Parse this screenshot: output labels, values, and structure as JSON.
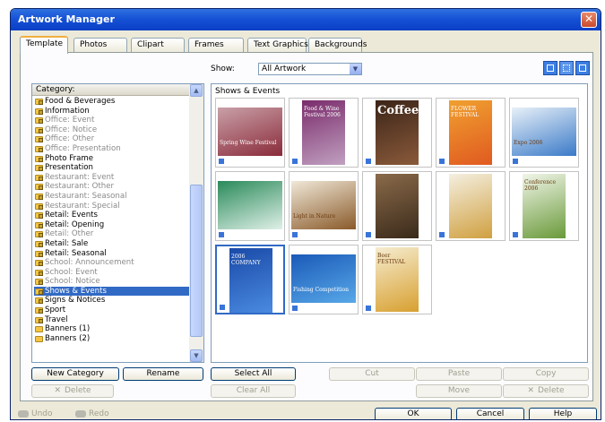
{
  "window": {
    "title": "Artwork Manager",
    "close_glyph": "✕"
  },
  "tabs": [
    {
      "label": "Template",
      "active": true
    },
    {
      "label": "Photos"
    },
    {
      "label": "Clipart"
    },
    {
      "label": "Frames"
    },
    {
      "label": "Text Graphics"
    },
    {
      "label": "Backgrounds"
    }
  ],
  "filter": {
    "show_label": "Show:",
    "show_value": "All Artwork"
  },
  "category": {
    "header": "Category:",
    "items": [
      {
        "label": "Food & Beverages"
      },
      {
        "label": "Information"
      },
      {
        "label": "Office: Event",
        "grey": true
      },
      {
        "label": "Office: Notice",
        "grey": true
      },
      {
        "label": "Office: Other",
        "grey": true
      },
      {
        "label": "Office: Presentation",
        "grey": true
      },
      {
        "label": "Photo Frame"
      },
      {
        "label": "Presentation"
      },
      {
        "label": "Restaurant: Event",
        "grey": true
      },
      {
        "label": "Restaurant: Other",
        "grey": true
      },
      {
        "label": "Restaurant: Seasonal",
        "grey": true
      },
      {
        "label": "Restaurant: Special",
        "grey": true
      },
      {
        "label": "Retail: Events"
      },
      {
        "label": "Retail: Opening"
      },
      {
        "label": "Retail: Other",
        "grey": true
      },
      {
        "label": "Retail: Sale"
      },
      {
        "label": "Retail: Seasonal"
      },
      {
        "label": "School: Announcement",
        "grey": true
      },
      {
        "label": "School: Event",
        "grey": true
      },
      {
        "label": "School: Notice",
        "grey": true
      },
      {
        "label": "Shows & Events",
        "selected": true
      },
      {
        "label": "Signs & Notices"
      },
      {
        "label": "Sport"
      },
      {
        "label": "Travel"
      },
      {
        "label": "Banners (1)",
        "unlocked": true
      },
      {
        "label": "Banners (2)",
        "unlocked": true
      }
    ]
  },
  "artwork": {
    "heading": "Shows & Events",
    "thumbnails": [
      {
        "name": "spring-wine-festival",
        "text": "Spring Wine Festival",
        "colors": [
          "#c9a0a8",
          "#8a2b3a"
        ]
      },
      {
        "name": "food-wine-festival",
        "text": "Food & Wine Festival 2006",
        "colors": [
          "#7a2b6b",
          "#c0a0c0"
        ]
      },
      {
        "name": "coffee",
        "text": "Coffee",
        "colors": [
          "#3b2418",
          "#8a5a3a"
        ]
      },
      {
        "name": "flower-festival",
        "text": "FLOWER FESTIVAL",
        "colors": [
          "#f0a030",
          "#e05a20"
        ]
      },
      {
        "name": "expo-2006",
        "text": "Expo 2006",
        "colors": [
          "#e8f0f8",
          "#3a7ac8"
        ]
      },
      {
        "name": "green-event",
        "text": "",
        "colors": [
          "#2a8a5a",
          "#e0f0e8"
        ]
      },
      {
        "name": "light-in-nature",
        "text": "Light in Nature",
        "colors": [
          "#f0e8d8",
          "#8a5a2a"
        ]
      },
      {
        "name": "wood-carving",
        "text": "",
        "colors": [
          "#8a6a4a",
          "#3a2a1a"
        ]
      },
      {
        "name": "garden-show",
        "text": "",
        "colors": [
          "#f4efe0",
          "#d0a040"
        ]
      },
      {
        "name": "conference-2006",
        "text": "Conference 2006",
        "colors": [
          "#f0f5e8",
          "#6a9a3a"
        ]
      },
      {
        "name": "company-technology",
        "text": "2006 COMPANY",
        "colors": [
          "#1a4aa8",
          "#4a8ae0"
        ]
      },
      {
        "name": "fishing-competition",
        "text": "Fishing Competition",
        "colors": [
          "#1a5ab8",
          "#58a8e8"
        ]
      },
      {
        "name": "beer-festival",
        "text": "Beer FESTIVAL",
        "colors": [
          "#f5ecd0",
          "#d8a030"
        ]
      }
    ]
  },
  "buttons": {
    "new_category": "New Category",
    "rename": "Rename",
    "delete": "Delete",
    "select_all": "Select All",
    "clear_all": "Clear All",
    "cut": "Cut",
    "paste": "Paste",
    "copy": "Copy",
    "move": "Move",
    "delete_right": "Delete",
    "undo": "Undo",
    "redo": "Redo",
    "ok": "OK",
    "cancel": "Cancel",
    "help": "Help"
  }
}
